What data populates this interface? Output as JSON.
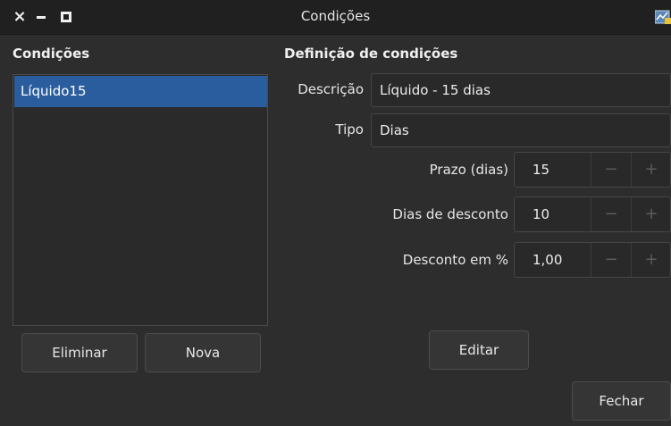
{
  "window": {
    "title": "Condições",
    "close_glyph": "×",
    "icons": {
      "close": "close-icon",
      "minimize": "minimize-icon",
      "maximize": "maximize-icon",
      "app": "app-icon"
    }
  },
  "conditions_panel": {
    "title": "Condições",
    "items": [
      {
        "label": "Líquido15",
        "selected": true
      }
    ],
    "delete_label": "Eliminar",
    "new_label": "Nova"
  },
  "definition": {
    "title": "Definição de condições",
    "description_label": "Descrição",
    "description_value": "Líquido - 15 dias",
    "type_label": "Tipo",
    "type_value": "Dias",
    "term_label": "Prazo (dias)",
    "term_value": "15",
    "discount_days_label": "Dias de desconto",
    "discount_days_value": "10",
    "discount_pct_label": "Desconto em %",
    "discount_pct_value": "1,00",
    "minus_glyph": "−",
    "plus_glyph": "+",
    "edit_label": "Editar"
  },
  "footer": {
    "close_label": "Fechar"
  },
  "colors": {
    "background": "#2d2d2d",
    "titlebar": "#202020",
    "selection": "#2a5d9e",
    "input_bg": "#292929",
    "button_bg": "#353535"
  }
}
